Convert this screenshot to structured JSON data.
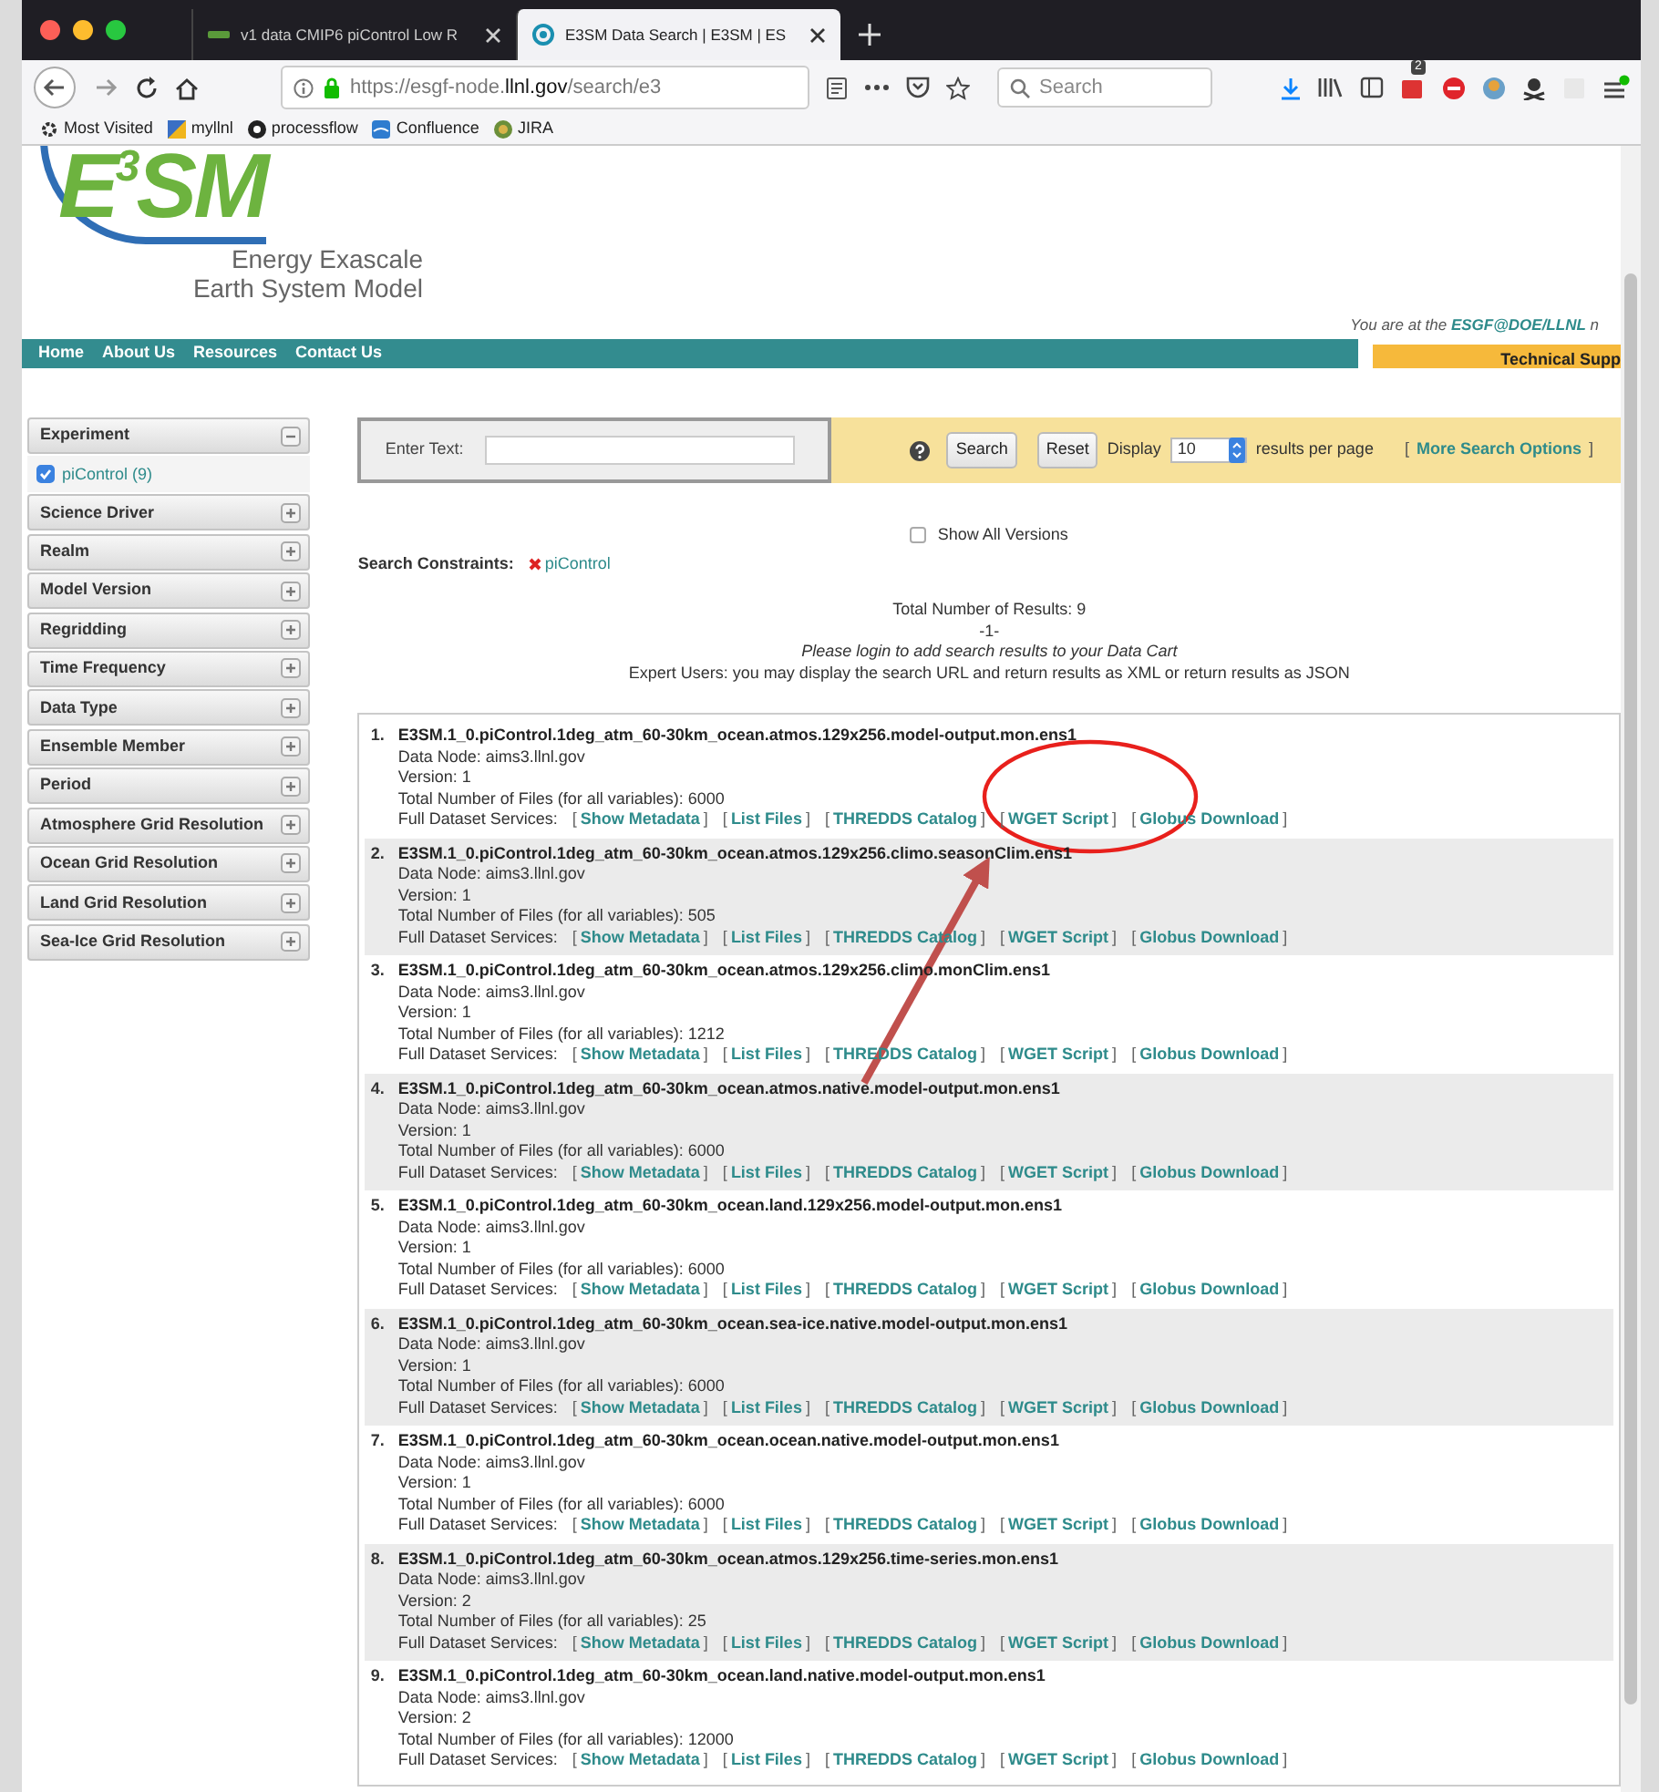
{
  "browser": {
    "tabs": [
      {
        "title": "v1 data CMIP6 piControl Low R",
        "selected": false
      },
      {
        "title": "E3SM Data Search | E3SM | ES",
        "selected": true
      }
    ],
    "url_host": "https://esgf-node.",
    "url_domain": "llnl.gov",
    "url_path": "/search/e3",
    "search_placeholder": "Search",
    "extension_badge": "2",
    "bookmarks": [
      {
        "label": "Most Visited"
      },
      {
        "label": "myllnl"
      },
      {
        "label": "processflow"
      },
      {
        "label": "Confluence"
      },
      {
        "label": "JIRA"
      }
    ]
  },
  "header": {
    "logo": "E$^{3}$SM",
    "tagline": [
      "Energy Exascale",
      "Earth System Model"
    ],
    "location_prefix": "You are at the",
    "location_link": "ESGF@DOE/LLNL",
    "location_suffix": "n"
  },
  "nav": {
    "items": [
      "Home",
      "About Us",
      "Resources",
      "Contact Us"
    ],
    "support": "Technical Supp"
  },
  "facets": [
    {
      "label": "Experiment",
      "expanded": true,
      "children": [
        {
          "label": "piControl (9)",
          "checked": true
        }
      ]
    },
    {
      "label": "Science Driver",
      "expanded": false
    },
    {
      "label": "Realm",
      "expanded": false
    },
    {
      "label": "Model Version",
      "expanded": false
    },
    {
      "label": "Regridding",
      "expanded": false
    },
    {
      "label": "Time Frequency",
      "expanded": false
    },
    {
      "label": "Data Type",
      "expanded": false
    },
    {
      "label": "Ensemble Member",
      "expanded": false
    },
    {
      "label": "Period",
      "expanded": false
    },
    {
      "label": "Atmosphere Grid Resolution",
      "expanded": false
    },
    {
      "label": "Ocean Grid Resolution",
      "expanded": false
    },
    {
      "label": "Land Grid Resolution",
      "expanded": false
    },
    {
      "label": "Sea-Ice Grid Resolution",
      "expanded": false
    }
  ],
  "search": {
    "label": "Enter Text:",
    "search_button": "Search",
    "reset_button": "Reset",
    "display_label": "Display",
    "display_value": "10",
    "per_page": "results per page",
    "more_open": "[",
    "more_link": "More Search Options",
    "more_close": "]"
  },
  "show_all_versions": {
    "label": "Show All Versions",
    "checked": false
  },
  "constraints": {
    "label": "Search Constraints:",
    "items": [
      "piControl"
    ]
  },
  "summary": {
    "total": "Total Number of Results: 9",
    "page": "-1-",
    "login": "Please login to add search results to your Data Cart",
    "expert": "Expert Users: you may display the search URL and",
    "xml_link": "return results as XML",
    "or": "or",
    "json_link": "return results as JSON"
  },
  "results": {
    "bracket_open": "[",
    "bracket_close": "]",
    "items": [
      {
        "number": "1.",
        "title": "E3SM.1_0.piControl.1deg_atm_60-30km_ocean.atmos.129x256.model-output.mon.ens1",
        "node": "Data Node: aims3.llnl.gov",
        "version": "Version: 1",
        "files": "Total Number of Files (for all variables): 6000",
        "services_label": "Full Dataset Services:",
        "services": [
          "Show Metadata",
          "List Files",
          "THREDDS Catalog",
          "WGET Script",
          "Globus Download"
        ]
      },
      {
        "number": "2.",
        "title": "E3SM.1_0.piControl.1deg_atm_60-30km_ocean.atmos.129x256.climo.seasonClim.ens1",
        "node": "Data Node: aims3.llnl.gov",
        "version": "Version: 1",
        "files": "Total Number of Files (for all variables): 505",
        "services_label": "Full Dataset Services:",
        "services": [
          "Show Metadata",
          "List Files",
          "THREDDS Catalog",
          "WGET Script",
          "Globus Download"
        ]
      },
      {
        "number": "3.",
        "title": "E3SM.1_0.piControl.1deg_atm_60-30km_ocean.atmos.129x256.climo.monClim.ens1",
        "node": "Data Node: aims3.llnl.gov",
        "version": "Version: 1",
        "files": "Total Number of Files (for all variables): 1212",
        "services_label": "Full Dataset Services:",
        "services": [
          "Show Metadata",
          "List Files",
          "THREDDS Catalog",
          "WGET Script",
          "Globus Download"
        ]
      },
      {
        "number": "4.",
        "title": "E3SM.1_0.piControl.1deg_atm_60-30km_ocean.atmos.native.model-output.mon.ens1",
        "node": "Data Node: aims3.llnl.gov",
        "version": "Version: 1",
        "files": "Total Number of Files (for all variables): 6000",
        "services_label": "Full Dataset Services:",
        "services": [
          "Show Metadata",
          "List Files",
          "THREDDS Catalog",
          "WGET Script",
          "Globus Download"
        ]
      },
      {
        "number": "5.",
        "title": "E3SM.1_0.piControl.1deg_atm_60-30km_ocean.land.129x256.model-output.mon.ens1",
        "node": "Data Node: aims3.llnl.gov",
        "version": "Version: 1",
        "files": "Total Number of Files (for all variables): 6000",
        "services_label": "Full Dataset Services:",
        "services": [
          "Show Metadata",
          "List Files",
          "THREDDS Catalog",
          "WGET Script",
          "Globus Download"
        ]
      },
      {
        "number": "6.",
        "title": "E3SM.1_0.piControl.1deg_atm_60-30km_ocean.sea-ice.native.model-output.mon.ens1",
        "node": "Data Node: aims3.llnl.gov",
        "version": "Version: 1",
        "files": "Total Number of Files (for all variables): 6000",
        "services_label": "Full Dataset Services:",
        "services": [
          "Show Metadata",
          "List Files",
          "THREDDS Catalog",
          "WGET Script",
          "Globus Download"
        ]
      },
      {
        "number": "7.",
        "title": "E3SM.1_0.piControl.1deg_atm_60-30km_ocean.ocean.native.model-output.mon.ens1",
        "node": "Data Node: aims3.llnl.gov",
        "version": "Version: 1",
        "files": "Total Number of Files (for all variables): 6000",
        "services_label": "Full Dataset Services:",
        "services": [
          "Show Metadata",
          "List Files",
          "THREDDS Catalog",
          "WGET Script",
          "Globus Download"
        ]
      },
      {
        "number": "8.",
        "title": "E3SM.1_0.piControl.1deg_atm_60-30km_ocean.atmos.129x256.time-series.mon.ens1",
        "node": "Data Node: aims3.llnl.gov",
        "version": "Version: 2",
        "files": "Total Number of Files (for all variables): 25",
        "services_label": "Full Dataset Services:",
        "services": [
          "Show Metadata",
          "List Files",
          "THREDDS Catalog",
          "WGET Script",
          "Globus Download"
        ]
      },
      {
        "number": "9.",
        "title": "E3SM.1_0.piControl.1deg_atm_60-30km_ocean.land.native.model-output.mon.ens1",
        "node": "Data Node: aims3.llnl.gov",
        "version": "Version: 2",
        "files": "Total Number of Files (for all variables): 12000",
        "services_label": "Full Dataset Services:",
        "services": [
          "Show Metadata",
          "List Files",
          "THREDDS Catalog",
          "WGET Script",
          "Globus Download"
        ]
      }
    ]
  }
}
